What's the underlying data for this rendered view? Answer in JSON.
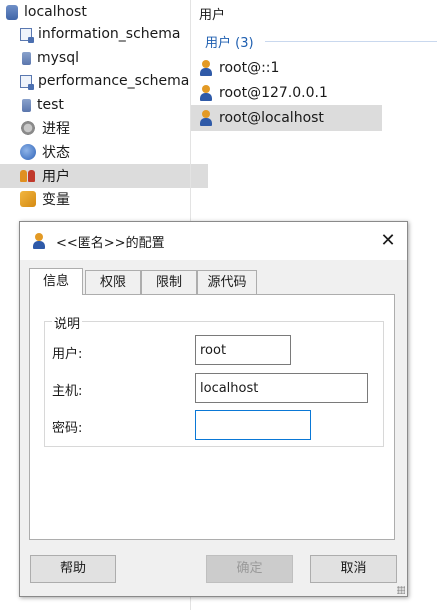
{
  "tree": {
    "items": [
      {
        "label": "localhost",
        "icon": "database-server-icon",
        "indent": 0
      },
      {
        "label": "information_schema",
        "icon": "schema-icon",
        "indent": 1
      },
      {
        "label": "mysql",
        "icon": "table-icon",
        "indent": 1
      },
      {
        "label": "performance_schema",
        "icon": "schema-icon",
        "indent": 1
      },
      {
        "label": "test",
        "icon": "table-icon",
        "indent": 1
      },
      {
        "label": "进程",
        "icon": "process-icon",
        "indent": 1
      },
      {
        "label": "状态",
        "icon": "status-icon",
        "indent": 1
      },
      {
        "label": "用户",
        "icon": "users-icon",
        "indent": 1,
        "selected": true
      },
      {
        "label": "变量",
        "icon": "variables-icon",
        "indent": 1
      }
    ]
  },
  "right_pane": {
    "title": "用户",
    "group_header": "用户 (3)",
    "users": [
      {
        "label": "root@::1"
      },
      {
        "label": "root@127.0.0.1"
      },
      {
        "label": "root@localhost",
        "selected": true
      }
    ]
  },
  "dialog": {
    "title": "<<匿名>>的配置",
    "close_symbol": "✕",
    "tabs": [
      "信息",
      "权限",
      "限制",
      "源代码"
    ],
    "active_tab": "信息",
    "section_legend": "说明",
    "fields": {
      "user_label": "用户:",
      "user_value": "root",
      "host_label": "主机:",
      "host_value": "localhost",
      "password_label": "密码:",
      "password_value": ""
    },
    "buttons": {
      "help": "帮助",
      "ok": "确定",
      "cancel": "取消"
    }
  },
  "colors": {
    "selection": "#dcdcdc",
    "group_header": "#1f5fb0",
    "focus_border": "#0a78d6",
    "dialog_bg": "#f0f0f0"
  }
}
